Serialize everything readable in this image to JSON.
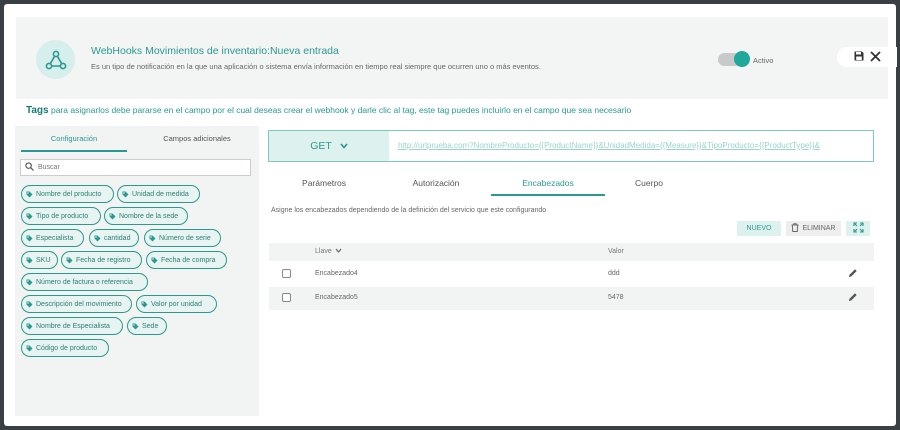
{
  "header": {
    "title": "WebHooks Movimientos de inventario:Nueva entrada",
    "description": "Es un tipo de notificación en la que una aplicación o sistema envía información en tiempo real siempre que ocurren uno o más eventos.",
    "toggle_label": "Activo",
    "toggle_on": true,
    "icon": "webhook-icon"
  },
  "tags_line": {
    "bold": "Tags",
    "text": " para asignarlos debe pararse en el campo por el cual deseas crear el webhook y darle clic al tag, este tag puedes incluirlo en el campo que sea necesario"
  },
  "left": {
    "tabs": [
      "Configuración",
      "Campos adicionales"
    ],
    "active_tab": 0,
    "search_placeholder": "Buscar",
    "tags": [
      "Nombre del producto",
      "Unidad de medida",
      "Tipo de producto",
      "Nombre de la sede",
      "Especialista",
      "cantidad",
      "Número de serie",
      "SKU",
      "Fecha de registro",
      "Fecha de compra",
      "Número de factura o referencia",
      "Descripción del movimiento",
      "Valor por unidad",
      "Nombre de Especialista",
      "Sede",
      "Código de producto"
    ]
  },
  "request": {
    "method": "GET",
    "url": "http://urlprueba.com?NombreProducto={{ProductName}}&UnidadMedida={{Measure}}&TipoProducto={{ProductType}}&"
  },
  "tabs": [
    "Parámetros",
    "Autorización",
    "Encabezados",
    "Cuerpo"
  ],
  "active_tab": 2,
  "hint": "Asigne los encabezados dependiendo de la definición del servicio que este configurando",
  "buttons": {
    "new": "NUEVO",
    "delete": "ELIMINAR"
  },
  "table": {
    "headers": [
      "Llave",
      "Valor"
    ],
    "rows": [
      {
        "key": "Encabezado4",
        "value": "ddd"
      },
      {
        "key": "Encabezado5",
        "value": "5478"
      }
    ]
  },
  "colors": {
    "accent": "#2a9a90",
    "accent_light": "#ddf1ee"
  }
}
